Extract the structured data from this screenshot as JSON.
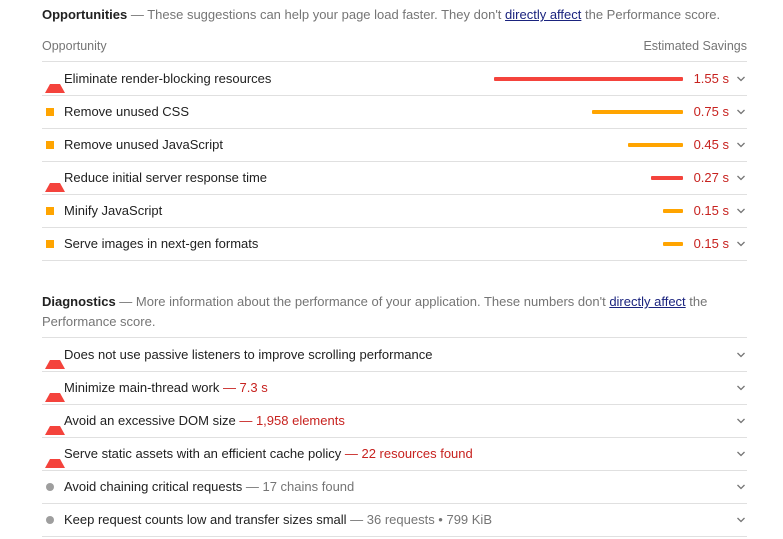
{
  "opportunities": {
    "title": "Opportunities",
    "desc_before": " — These suggestions can help your page load faster. They don't ",
    "link": "directly affect",
    "desc_after": " the Performance score.",
    "col_left": "Opportunity",
    "col_right": "Estimated Savings",
    "items": [
      {
        "label": "Eliminate render-blocking resources",
        "saving": "1.55 s",
        "severity": "fail",
        "saving_fraction": 1.0
      },
      {
        "label": "Remove unused CSS",
        "saving": "0.75 s",
        "severity": "average",
        "saving_fraction": 0.48
      },
      {
        "label": "Remove unused JavaScript",
        "saving": "0.45 s",
        "severity": "average",
        "saving_fraction": 0.29
      },
      {
        "label": "Reduce initial server response time",
        "saving": "0.27 s",
        "severity": "fail",
        "saving_fraction": 0.17
      },
      {
        "label": "Minify JavaScript",
        "saving": "0.15 s",
        "severity": "average",
        "saving_fraction": 0.1
      },
      {
        "label": "Serve images in next-gen formats",
        "saving": "0.15 s",
        "severity": "average",
        "saving_fraction": 0.1
      }
    ]
  },
  "diagnostics": {
    "title": "Diagnostics",
    "desc_before": " — More information about the performance of your application. These numbers don't ",
    "link": "directly affect",
    "desc_after": " the Performance score.",
    "items": [
      {
        "label": "Does not use passive listeners to improve scrolling performance",
        "detail": "",
        "severity": "fail"
      },
      {
        "label": "Minimize main-thread work",
        "detail": " — 7.3 s",
        "severity": "fail"
      },
      {
        "label": "Avoid an excessive DOM size",
        "detail": " — 1,958 elements",
        "severity": "fail"
      },
      {
        "label": "Serve static assets with an efficient cache policy",
        "detail": " — 22 resources found",
        "severity": "fail"
      },
      {
        "label": "Avoid chaining critical requests",
        "detail": " — 17 chains found",
        "severity": "info"
      },
      {
        "label": "Keep request counts low and transfer sizes small",
        "detail": " — 36 requests • 799 KiB",
        "severity": "info"
      }
    ]
  },
  "colors": {
    "fail": "#f4433c",
    "average": "#ffa400",
    "info": "#9e9e9e",
    "saving_text": "#c7221f",
    "link": "#1a237e"
  },
  "icons": {
    "fail": "warning-triangle-icon",
    "average": "square-icon",
    "info": "info-circle-icon",
    "expand": "chevron-down-icon"
  }
}
